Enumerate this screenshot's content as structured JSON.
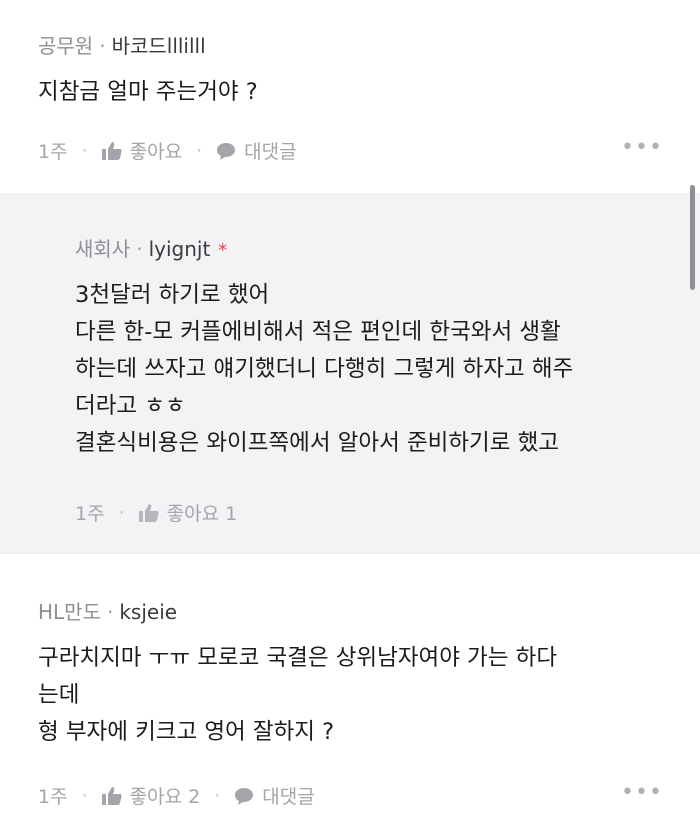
{
  "comments": [
    {
      "company": "공무원",
      "nickname": "바코드lllilll",
      "body": [
        "지참금 얼마 주는거야 ?"
      ],
      "time": "1주",
      "like_label": "좋아요",
      "reply_label": "대댓글",
      "more": "•••"
    },
    {
      "company": "새회사",
      "nickname": "lyignjt",
      "author_mark": "*",
      "body": [
        "3천달러 하기로 했어",
        "다른 한-모 커플에비해서 적은 편인데 한국와서 생활",
        "하는데 쓰자고 얘기했더니 다행히 그렇게 하자고 해주",
        "더라고 ㅎㅎ",
        "결혼식비용은 와이프쪽에서 알아서 준비하기로 했고"
      ],
      "time": "1주",
      "like_label": "좋아요 1"
    },
    {
      "company": "HL만도",
      "nickname": "ksjeie",
      "body": [
        "구라치지마 ㅜㅠ 모로코 국결은 상위남자여야 가는 하다",
        "는데",
        "형 부자에 키크고 영어 잘하지 ?"
      ],
      "time": "1주",
      "like_label": "좋아요 2",
      "reply_label": "대댓글",
      "more": "•••"
    }
  ],
  "separator": "·",
  "action_separator": "·",
  "icons": {
    "like": "thumbs-up-icon",
    "reply": "speech-bubble-icon"
  },
  "colors": {
    "reply_background": "#f3f3f5",
    "author_mark": "#e0464a"
  }
}
